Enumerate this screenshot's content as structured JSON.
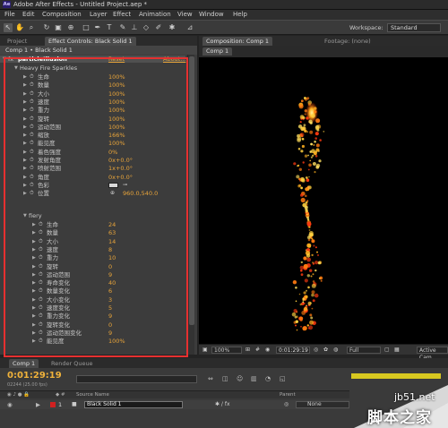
{
  "app": {
    "title": "Adobe After Effects - Untitled Project.aep *",
    "logo_text": "Ae"
  },
  "menu": [
    "File",
    "Edit",
    "Composition",
    "Layer",
    "Effect",
    "Animation",
    "View",
    "Window",
    "Help"
  ],
  "toolbar": {
    "workspace_label": "Workspace:",
    "workspace_value": "Standard"
  },
  "left_tabs": {
    "project": "Project",
    "effect_controls": "Effect Controls: Black Solid 1"
  },
  "effect_controls": {
    "breadcrumb": "Comp 1 • Black Solid 1",
    "effect_name": "particleIllusion",
    "reset": "Reset",
    "about": "About...",
    "emitter1_name": "Heavy Fire Sparkles",
    "emitter1_props": [
      {
        "label": "生命",
        "value": "100%"
      },
      {
        "label": "数量",
        "value": "100%"
      },
      {
        "label": "大小",
        "value": "100%"
      },
      {
        "label": "速度",
        "value": "100%"
      },
      {
        "label": "重力",
        "value": "100%"
      },
      {
        "label": "旋转",
        "value": "100%"
      },
      {
        "label": "运动范围",
        "value": "100%"
      },
      {
        "label": "缩放",
        "value": "166%"
      },
      {
        "label": "能见度",
        "value": "100%"
      },
      {
        "label": "着色强度",
        "value": "0%"
      },
      {
        "label": "发射角度",
        "value": "0x+0.0°"
      },
      {
        "label": "喷射范围",
        "value": "1x+0.0°"
      },
      {
        "label": "角度",
        "value": "0x+0.0°"
      },
      {
        "label": "色彩",
        "value": ""
      },
      {
        "label": "位置",
        "value": "960.0,540.0"
      }
    ],
    "emitter2_name": "fiery",
    "emitter2_props": [
      {
        "label": "生命",
        "value": "24"
      },
      {
        "label": "数量",
        "value": "63"
      },
      {
        "label": "大小",
        "value": "14"
      },
      {
        "label": "速度",
        "value": "8"
      },
      {
        "label": "重力",
        "value": "10"
      },
      {
        "label": "旋转",
        "value": "0"
      },
      {
        "label": "运动范围",
        "value": "9"
      },
      {
        "label": "寿命变化",
        "value": "40"
      },
      {
        "label": "数量变化",
        "value": "6"
      },
      {
        "label": "大小变化",
        "value": "3"
      },
      {
        "label": "速度变化",
        "value": "5"
      },
      {
        "label": "重力变化",
        "value": "9"
      },
      {
        "label": "旋转变化",
        "value": "0"
      },
      {
        "label": "运动范围变化",
        "value": "9"
      },
      {
        "label": "能见度",
        "value": "100%"
      }
    ]
  },
  "composition": {
    "tab": "Composition: Comp 1",
    "footage_tab": "Footage: (none)",
    "comp_tab": "Comp 1",
    "zoom": "100%",
    "timecode": "0:01:29:19",
    "resolution": "Full",
    "active_camera": "Active Cam"
  },
  "timeline": {
    "tab_comp": "Comp 1",
    "tab_render": "Render Queue",
    "timecode": "0:01:29:19",
    "fps": "02244 (25.00 fps)",
    "col_source": "Source Name",
    "col_parent": "Parent",
    "layer_num": "1",
    "layer_name": "Black Solid 1",
    "parent_value": "None"
  },
  "watermark": {
    "site": "jb51.net",
    "text": "脚本之家"
  },
  "colors": {
    "accent_orange": "#e8a43a",
    "highlight_red": "#e63030",
    "timecode": "#f0b23a"
  }
}
